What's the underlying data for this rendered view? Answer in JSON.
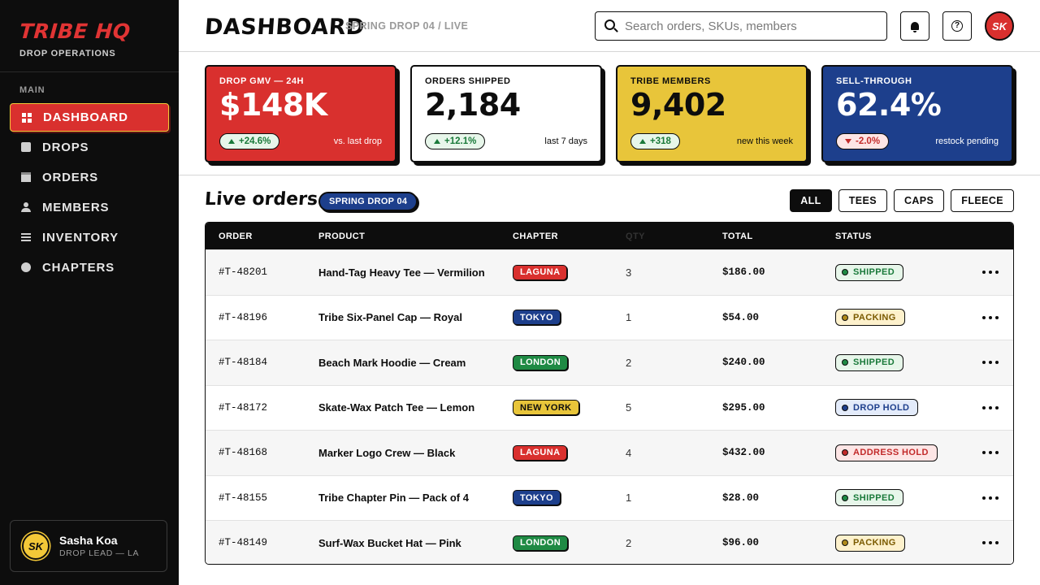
{
  "brand": {
    "title": "TRIBE HQ",
    "subtitle": "DROP OPERATIONS"
  },
  "sidebar": {
    "section_label": "MAIN",
    "items": [
      {
        "label": "DASHBOARD",
        "icon": "grid-icon"
      },
      {
        "label": "DROPS",
        "icon": "bag-icon"
      },
      {
        "label": "ORDERS",
        "icon": "box-icon"
      },
      {
        "label": "MEMBERS",
        "icon": "user-icon"
      },
      {
        "label": "INVENTORY",
        "icon": "list-icon"
      },
      {
        "label": "CHAPTERS",
        "icon": "dot-icon"
      }
    ],
    "active_item": "DASHBOARD"
  },
  "user": {
    "initials": "SK",
    "name": "Sasha Koa",
    "role": "DROP LEAD — LA"
  },
  "header": {
    "title": "DASHBOARD",
    "breadcrumb": "SPRING DROP 04 / LIVE",
    "search_placeholder": "Search orders, SKUs, members",
    "notifications_icon": "bell-icon",
    "help_icon": "help-icon",
    "help_glyph": "?",
    "avatar_initials": "SK"
  },
  "kpis": [
    {
      "label": "DROP GMV — 24H",
      "value": "$148K",
      "delta": "+24.6%",
      "direction": "up",
      "note": "vs. last drop",
      "color": "#d9302e"
    },
    {
      "label": "ORDERS SHIPPED",
      "value": "2,184",
      "delta": "+12.1%",
      "direction": "up",
      "note": "last 7 days",
      "color": "#ffffff"
    },
    {
      "label": "TRIBE MEMBERS",
      "value": "9,402",
      "delta": "+318",
      "direction": "up",
      "note": "new this week",
      "color": "#e8c53a"
    },
    {
      "label": "SELL-THROUGH",
      "value": "62.4%",
      "delta": "-2.0%",
      "direction": "down",
      "note": "restock pending",
      "color": "#1d3f8c"
    }
  ],
  "orders": {
    "title": "Live orders",
    "badge": "SPRING DROP 04",
    "filters": [
      "ALL",
      "TEES",
      "CAPS",
      "FLEECE"
    ],
    "active_filter": "ALL",
    "columns": [
      "ORDER",
      "PRODUCT",
      "CHAPTER",
      "QTY",
      "TOTAL",
      "STATUS"
    ],
    "rows": [
      {
        "order": "#T-48201",
        "product": "Hand-Tag Heavy Tee — Vermilion",
        "chapter": "LAGUNA",
        "qty": "3",
        "total": "$186.00",
        "status": "SHIPPED"
      },
      {
        "order": "#T-48196",
        "product": "Tribe Six-Panel Cap — Royal",
        "chapter": "TOKYO",
        "qty": "1",
        "total": "$54.00",
        "status": "PACKING"
      },
      {
        "order": "#T-48184",
        "product": "Beach Mark Hoodie — Cream",
        "chapter": "LONDON",
        "qty": "2",
        "total": "$240.00",
        "status": "SHIPPED"
      },
      {
        "order": "#T-48172",
        "product": "Skate-Wax Patch Tee — Lemon",
        "chapter": "NEW YORK",
        "qty": "5",
        "total": "$295.00",
        "status": "DROP HOLD"
      },
      {
        "order": "#T-48168",
        "product": "Marker Logo Crew — Black",
        "chapter": "LAGUNA",
        "qty": "4",
        "total": "$432.00",
        "status": "ADDRESS HOLD"
      },
      {
        "order": "#T-48155",
        "product": "Tribe Chapter Pin — Pack of 4",
        "chapter": "TOKYO",
        "qty": "1",
        "total": "$28.00",
        "status": "SHIPPED"
      },
      {
        "order": "#T-48149",
        "product": "Surf-Wax Bucket Hat — Pink",
        "chapter": "LONDON",
        "qty": "2",
        "total": "$96.00",
        "status": "PACKING"
      }
    ]
  },
  "colors": {
    "chapters": {
      "LAGUNA": "#d9302e",
      "TOKYO": "#1d3f8c",
      "LONDON": "#1f8a44",
      "NEW YORK": "#e8c53a"
    },
    "status": {
      "SHIPPED": {
        "bg": "#e7f6ea",
        "fg": "#1a7a3a",
        "dot": "#1f8a44"
      },
      "PACKING": {
        "bg": "#fdf1cc",
        "fg": "#7a5a00",
        "dot": "#b08a1a"
      },
      "DROP HOLD": {
        "bg": "#e3ebfa",
        "fg": "#1d3f8c",
        "dot": "#1d3f8c"
      },
      "ADDRESS HOLD": {
        "bg": "#fde5e5",
        "fg": "#c22a2a",
        "dot": "#c22a2a"
      }
    }
  }
}
